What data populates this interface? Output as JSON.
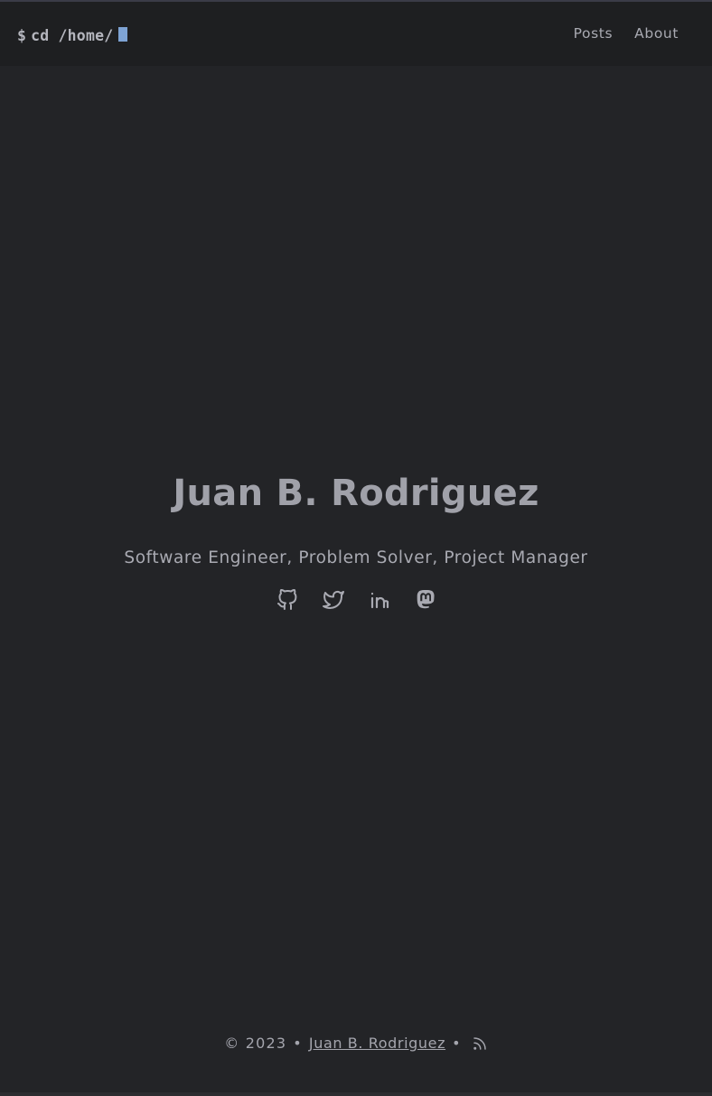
{
  "header": {
    "logo_prompt": "$",
    "logo_text": "cd /home/",
    "nav": [
      {
        "label": "Posts"
      },
      {
        "label": "About"
      }
    ]
  },
  "hero": {
    "name": "Juan B. Rodriguez",
    "tagline": "Software Engineer, Problem Solver, Project Manager",
    "socials": [
      {
        "icon": "github-icon"
      },
      {
        "icon": "twitter-icon"
      },
      {
        "icon": "linkedin-icon"
      },
      {
        "icon": "mastodon-icon"
      }
    ]
  },
  "footer": {
    "copyright": "© 2023",
    "separator": "•",
    "author": "Juan B. Rodriguez",
    "rss_icon": "rss-icon"
  },
  "colors": {
    "background": "#232427",
    "navbar": "#1e1f21",
    "cursor": "#7ea3d4",
    "text": "#a9aab2"
  }
}
